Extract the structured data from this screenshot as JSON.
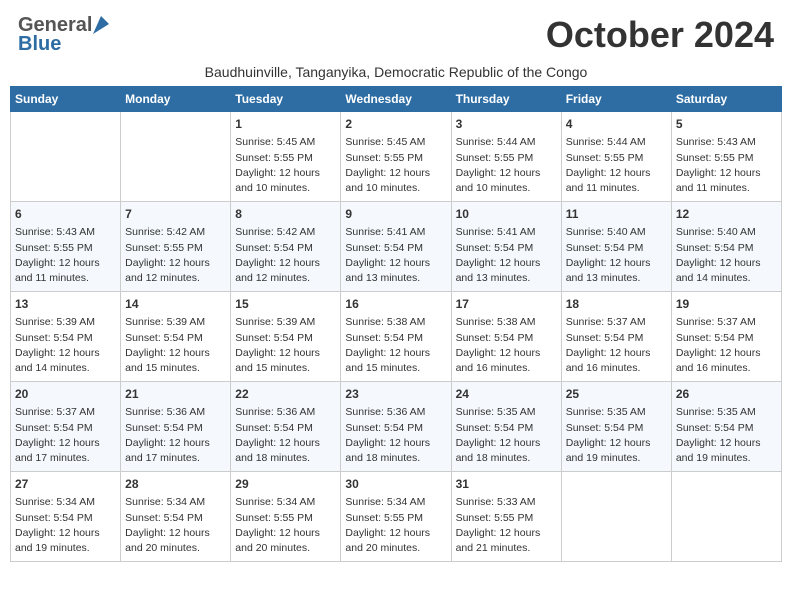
{
  "logo": {
    "general": "General",
    "blue": "Blue"
  },
  "title": "October 2024",
  "subtitle": "Baudhuinville, Tanganyika, Democratic Republic of the Congo",
  "days_of_week": [
    "Sunday",
    "Monday",
    "Tuesday",
    "Wednesday",
    "Thursday",
    "Friday",
    "Saturday"
  ],
  "weeks": [
    [
      {
        "day": "",
        "info": ""
      },
      {
        "day": "",
        "info": ""
      },
      {
        "day": "1",
        "info": "Sunrise: 5:45 AM\nSunset: 5:55 PM\nDaylight: 12 hours\nand 10 minutes."
      },
      {
        "day": "2",
        "info": "Sunrise: 5:45 AM\nSunset: 5:55 PM\nDaylight: 12 hours\nand 10 minutes."
      },
      {
        "day": "3",
        "info": "Sunrise: 5:44 AM\nSunset: 5:55 PM\nDaylight: 12 hours\nand 10 minutes."
      },
      {
        "day": "4",
        "info": "Sunrise: 5:44 AM\nSunset: 5:55 PM\nDaylight: 12 hours\nand 11 minutes."
      },
      {
        "day": "5",
        "info": "Sunrise: 5:43 AM\nSunset: 5:55 PM\nDaylight: 12 hours\nand 11 minutes."
      }
    ],
    [
      {
        "day": "6",
        "info": "Sunrise: 5:43 AM\nSunset: 5:55 PM\nDaylight: 12 hours\nand 11 minutes."
      },
      {
        "day": "7",
        "info": "Sunrise: 5:42 AM\nSunset: 5:55 PM\nDaylight: 12 hours\nand 12 minutes."
      },
      {
        "day": "8",
        "info": "Sunrise: 5:42 AM\nSunset: 5:54 PM\nDaylight: 12 hours\nand 12 minutes."
      },
      {
        "day": "9",
        "info": "Sunrise: 5:41 AM\nSunset: 5:54 PM\nDaylight: 12 hours\nand 13 minutes."
      },
      {
        "day": "10",
        "info": "Sunrise: 5:41 AM\nSunset: 5:54 PM\nDaylight: 12 hours\nand 13 minutes."
      },
      {
        "day": "11",
        "info": "Sunrise: 5:40 AM\nSunset: 5:54 PM\nDaylight: 12 hours\nand 13 minutes."
      },
      {
        "day": "12",
        "info": "Sunrise: 5:40 AM\nSunset: 5:54 PM\nDaylight: 12 hours\nand 14 minutes."
      }
    ],
    [
      {
        "day": "13",
        "info": "Sunrise: 5:39 AM\nSunset: 5:54 PM\nDaylight: 12 hours\nand 14 minutes."
      },
      {
        "day": "14",
        "info": "Sunrise: 5:39 AM\nSunset: 5:54 PM\nDaylight: 12 hours\nand 15 minutes."
      },
      {
        "day": "15",
        "info": "Sunrise: 5:39 AM\nSunset: 5:54 PM\nDaylight: 12 hours\nand 15 minutes."
      },
      {
        "day": "16",
        "info": "Sunrise: 5:38 AM\nSunset: 5:54 PM\nDaylight: 12 hours\nand 15 minutes."
      },
      {
        "day": "17",
        "info": "Sunrise: 5:38 AM\nSunset: 5:54 PM\nDaylight: 12 hours\nand 16 minutes."
      },
      {
        "day": "18",
        "info": "Sunrise: 5:37 AM\nSunset: 5:54 PM\nDaylight: 12 hours\nand 16 minutes."
      },
      {
        "day": "19",
        "info": "Sunrise: 5:37 AM\nSunset: 5:54 PM\nDaylight: 12 hours\nand 16 minutes."
      }
    ],
    [
      {
        "day": "20",
        "info": "Sunrise: 5:37 AM\nSunset: 5:54 PM\nDaylight: 12 hours\nand 17 minutes."
      },
      {
        "day": "21",
        "info": "Sunrise: 5:36 AM\nSunset: 5:54 PM\nDaylight: 12 hours\nand 17 minutes."
      },
      {
        "day": "22",
        "info": "Sunrise: 5:36 AM\nSunset: 5:54 PM\nDaylight: 12 hours\nand 18 minutes."
      },
      {
        "day": "23",
        "info": "Sunrise: 5:36 AM\nSunset: 5:54 PM\nDaylight: 12 hours\nand 18 minutes."
      },
      {
        "day": "24",
        "info": "Sunrise: 5:35 AM\nSunset: 5:54 PM\nDaylight: 12 hours\nand 18 minutes."
      },
      {
        "day": "25",
        "info": "Sunrise: 5:35 AM\nSunset: 5:54 PM\nDaylight: 12 hours\nand 19 minutes."
      },
      {
        "day": "26",
        "info": "Sunrise: 5:35 AM\nSunset: 5:54 PM\nDaylight: 12 hours\nand 19 minutes."
      }
    ],
    [
      {
        "day": "27",
        "info": "Sunrise: 5:34 AM\nSunset: 5:54 PM\nDaylight: 12 hours\nand 19 minutes."
      },
      {
        "day": "28",
        "info": "Sunrise: 5:34 AM\nSunset: 5:54 PM\nDaylight: 12 hours\nand 20 minutes."
      },
      {
        "day": "29",
        "info": "Sunrise: 5:34 AM\nSunset: 5:55 PM\nDaylight: 12 hours\nand 20 minutes."
      },
      {
        "day": "30",
        "info": "Sunrise: 5:34 AM\nSunset: 5:55 PM\nDaylight: 12 hours\nand 20 minutes."
      },
      {
        "day": "31",
        "info": "Sunrise: 5:33 AM\nSunset: 5:55 PM\nDaylight: 12 hours\nand 21 minutes."
      },
      {
        "day": "",
        "info": ""
      },
      {
        "day": "",
        "info": ""
      }
    ]
  ]
}
